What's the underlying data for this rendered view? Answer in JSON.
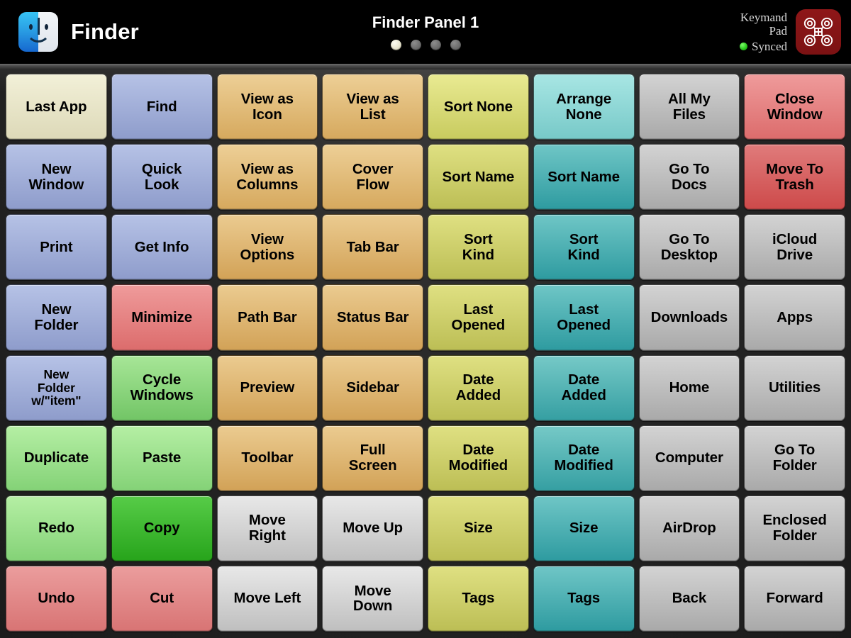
{
  "header": {
    "app_name": "Finder",
    "app_icon": "finder-face-icon",
    "panel_title": "Finder Panel 1",
    "pages": {
      "count": 4,
      "active_index": 0
    },
    "brand": {
      "line1": "Keymand",
      "line2": "Pad",
      "status": "Synced",
      "status_color": "#27c41a",
      "logo_name": "keymand-pad-logo",
      "logo_bg": "#7c1213"
    }
  },
  "pad": {
    "columns": 8,
    "rows": 8,
    "keys": [
      {
        "label": "Last App",
        "color": "c-cream",
        "hex": "#e6e3c6"
      },
      {
        "label": "Find",
        "color": "c-blue",
        "hex": "#a2aed9"
      },
      {
        "label": "View as\nIcon",
        "color": "c-tan",
        "hex": "#e0bb7a"
      },
      {
        "label": "View as\nList",
        "color": "c-tan",
        "hex": "#e0bb7a"
      },
      {
        "label": "Sort None",
        "color": "c-olive-l",
        "hex": "#d8da79"
      },
      {
        "label": "Arrange\nNone",
        "color": "c-cyan-l",
        "hex": "#8fd8d6"
      },
      {
        "label": "All My\nFiles",
        "color": "c-gray",
        "hex": "#bebebe"
      },
      {
        "label": "Close\nWindow",
        "color": "c-red-l",
        "hex": "#e38484"
      },
      {
        "label": "New\nWindow",
        "color": "c-blue",
        "hex": "#a2aed9"
      },
      {
        "label": "Quick\nLook",
        "color": "c-blue",
        "hex": "#a2aed9"
      },
      {
        "label": "View as\nColumns",
        "color": "c-tan",
        "hex": "#e0bb7a"
      },
      {
        "label": "Cover\nFlow",
        "color": "c-tan",
        "hex": "#e0bb7a"
      },
      {
        "label": "Sort Name",
        "color": "c-olive",
        "hex": "#cccc6b"
      },
      {
        "label": "Sort Name",
        "color": "c-teal",
        "hex": "#4eb0b3"
      },
      {
        "label": "Go To\nDocs",
        "color": "c-gray",
        "hex": "#bebebe"
      },
      {
        "label": "Move To\nTrash",
        "color": "c-red",
        "hex": "#d66262"
      },
      {
        "label": "Print",
        "color": "c-blue",
        "hex": "#a2aed9"
      },
      {
        "label": "Get Info",
        "color": "c-blue",
        "hex": "#a2aed9"
      },
      {
        "label": "View\nOptions",
        "color": "c-tan2",
        "hex": "#dfb673"
      },
      {
        "label": "Tab Bar",
        "color": "c-tan2",
        "hex": "#dfb673"
      },
      {
        "label": "Sort\nKind",
        "color": "c-olive",
        "hex": "#cccc6b"
      },
      {
        "label": "Sort\nKind",
        "color": "c-teal",
        "hex": "#4eb0b3"
      },
      {
        "label": "Go To\nDesktop",
        "color": "c-gray",
        "hex": "#bebebe"
      },
      {
        "label": "iCloud\nDrive",
        "color": "c-gray",
        "hex": "#bebebe"
      },
      {
        "label": "New\nFolder",
        "color": "c-blue",
        "hex": "#a2aed9"
      },
      {
        "label": "Minimize",
        "color": "c-red-l",
        "hex": "#e38484"
      },
      {
        "label": "Path Bar",
        "color": "c-tan2",
        "hex": "#dfb673"
      },
      {
        "label": "Status Bar",
        "color": "c-tan2",
        "hex": "#dfb673"
      },
      {
        "label": "Last\nOpened",
        "color": "c-olive",
        "hex": "#cccc6b"
      },
      {
        "label": "Last\nOpened",
        "color": "c-teal",
        "hex": "#4eb0b3"
      },
      {
        "label": "Downloads",
        "color": "c-gray",
        "hex": "#bebebe"
      },
      {
        "label": "Apps",
        "color": "c-gray",
        "hex": "#bebebe"
      },
      {
        "label": "New\nFolder\nw/\"item\"",
        "color": "c-blue",
        "hex": "#a2aed9",
        "small": true
      },
      {
        "label": "Cycle\nWindows",
        "color": "c-green",
        "hex": "#8cd67f"
      },
      {
        "label": "Preview",
        "color": "c-tan2",
        "hex": "#dfb673"
      },
      {
        "label": "Sidebar",
        "color": "c-tan2",
        "hex": "#dfb673"
      },
      {
        "label": "Date\nAdded",
        "color": "c-olive",
        "hex": "#cccc6b"
      },
      {
        "label": "Date\nAdded",
        "color": "c-teal2",
        "hex": "#52b3b4"
      },
      {
        "label": "Home",
        "color": "c-gray",
        "hex": "#bebebe"
      },
      {
        "label": "Utilities",
        "color": "c-gray",
        "hex": "#bebebe"
      },
      {
        "label": "Duplicate",
        "color": "c-green-l",
        "hex": "#9ce08d"
      },
      {
        "label": "Paste",
        "color": "c-green-l",
        "hex": "#9ce08d"
      },
      {
        "label": "Toolbar",
        "color": "c-tan2",
        "hex": "#dfb673"
      },
      {
        "label": "Full\nScreen",
        "color": "c-tan2",
        "hex": "#dfb673"
      },
      {
        "label": "Date\nModified",
        "color": "c-olive",
        "hex": "#cccc6b"
      },
      {
        "label": "Date\nModified",
        "color": "c-teal2",
        "hex": "#52b3b4"
      },
      {
        "label": "Computer",
        "color": "c-gray",
        "hex": "#bebebe"
      },
      {
        "label": "Go To\nFolder",
        "color": "c-gray",
        "hex": "#bebebe"
      },
      {
        "label": "Redo",
        "color": "c-green-l",
        "hex": "#9ce08d"
      },
      {
        "label": "Copy",
        "color": "c-green-s",
        "hex": "#3cb82f"
      },
      {
        "label": "Move\nRight",
        "color": "c-silver",
        "hex": "#d3d3d3"
      },
      {
        "label": "Move Up",
        "color": "c-silver",
        "hex": "#d3d3d3"
      },
      {
        "label": "Size",
        "color": "c-olive",
        "hex": "#cccc6b"
      },
      {
        "label": "Size",
        "color": "c-teal",
        "hex": "#4eb0b3"
      },
      {
        "label": "AirDrop",
        "color": "c-gray",
        "hex": "#bebebe"
      },
      {
        "label": "Enclosed\nFolder",
        "color": "c-gray",
        "hex": "#bebebe"
      },
      {
        "label": "Undo",
        "color": "c-salmon",
        "hex": "#e18a8a"
      },
      {
        "label": "Cut",
        "color": "c-salmon",
        "hex": "#e18a8a"
      },
      {
        "label": "Move Left",
        "color": "c-silver",
        "hex": "#d3d3d3"
      },
      {
        "label": "Move\nDown",
        "color": "c-silver",
        "hex": "#d3d3d3"
      },
      {
        "label": "Tags",
        "color": "c-olive",
        "hex": "#cccc6b"
      },
      {
        "label": "Tags",
        "color": "c-teal",
        "hex": "#4eb0b3"
      },
      {
        "label": "Back",
        "color": "c-gray",
        "hex": "#bebebe"
      },
      {
        "label": "Forward",
        "color": "c-gray",
        "hex": "#bebebe"
      }
    ]
  }
}
